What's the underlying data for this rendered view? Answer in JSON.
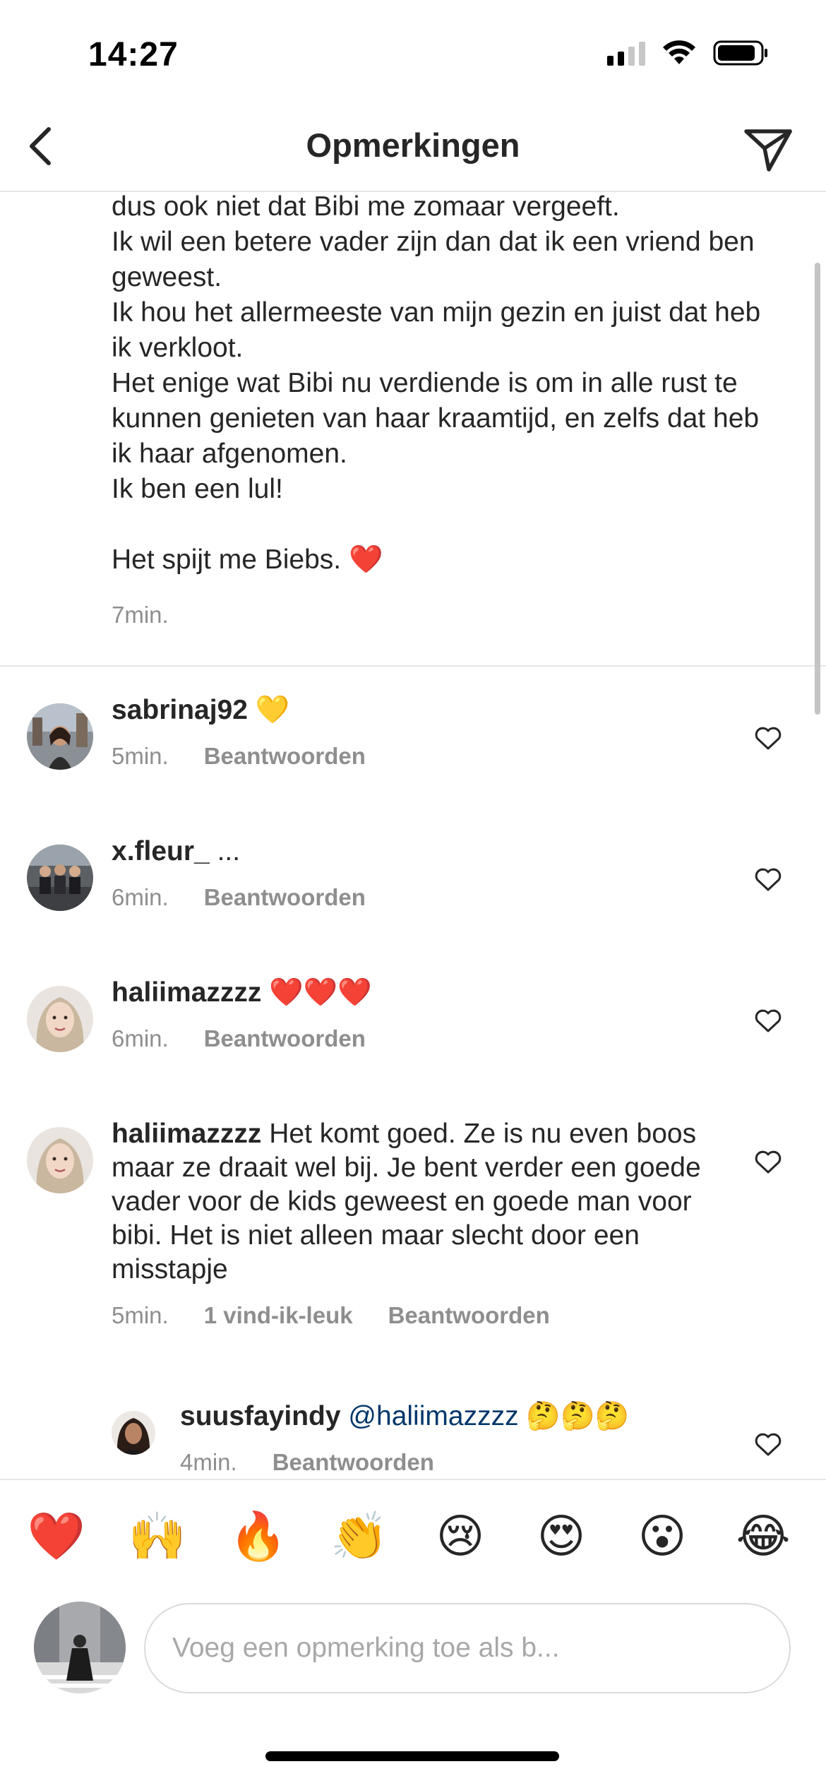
{
  "status_bar": {
    "time": "14:27"
  },
  "header": {
    "title": "Opmerkingen"
  },
  "caption": {
    "lines": [
      "dus ook niet dat Bibi me zomaar  vergeeft.",
      "Ik wil een betere vader zijn dan dat ik een vriend ben geweest.",
      "Ik hou het allermeeste van mijn gezin en juist dat heb ik verkloot.",
      "Het enige wat Bibi nu verdiende is om in alle rust te kunnen genieten van haar kraamtijd, en zelfs dat heb ik haar afgenomen.",
      "Ik ben een lul!"
    ],
    "closing": "Het spijt me Biebs.",
    "closing_emoji": "❤️",
    "time": "7min."
  },
  "comments": [
    {
      "user": "sabrinaj92",
      "text": "💛",
      "time": "5min.",
      "likes": "",
      "reply": "Beantwoorden"
    },
    {
      "user": "x.fleur_",
      "text": "...",
      "time": "6min.",
      "likes": "",
      "reply": "Beantwoorden"
    },
    {
      "user": "haliimazzzz",
      "text": "❤️❤️❤️",
      "time": "6min.",
      "likes": "",
      "reply": "Beantwoorden"
    },
    {
      "user": "haliimazzzz",
      "text": "Het komt goed. Ze is nu even boos maar ze draait wel bij. Je bent verder een goede vader voor de kids geweest en goede man voor bibi. Het is niet alleen maar slecht door een misstapje",
      "time": "5min.",
      "likes": "1 vind-ik-leuk",
      "reply": "Beantwoorden"
    }
  ],
  "reply": {
    "user": "suusfayindy",
    "mention": "@haliimazzzz",
    "text": "🤔🤔🤔",
    "time": "4min.",
    "reply": "Beantwoorden"
  },
  "emoji_bar": [
    "❤️",
    "🙌",
    "🔥",
    "👏",
    "😢",
    "😍",
    "😮",
    "😂"
  ],
  "input": {
    "placeholder": "Voeg een opmerking toe als b..."
  },
  "colors": {
    "text": "#262626",
    "secondary": "#8e8e8e",
    "link": "#00376b",
    "heart": "#e0142b"
  }
}
